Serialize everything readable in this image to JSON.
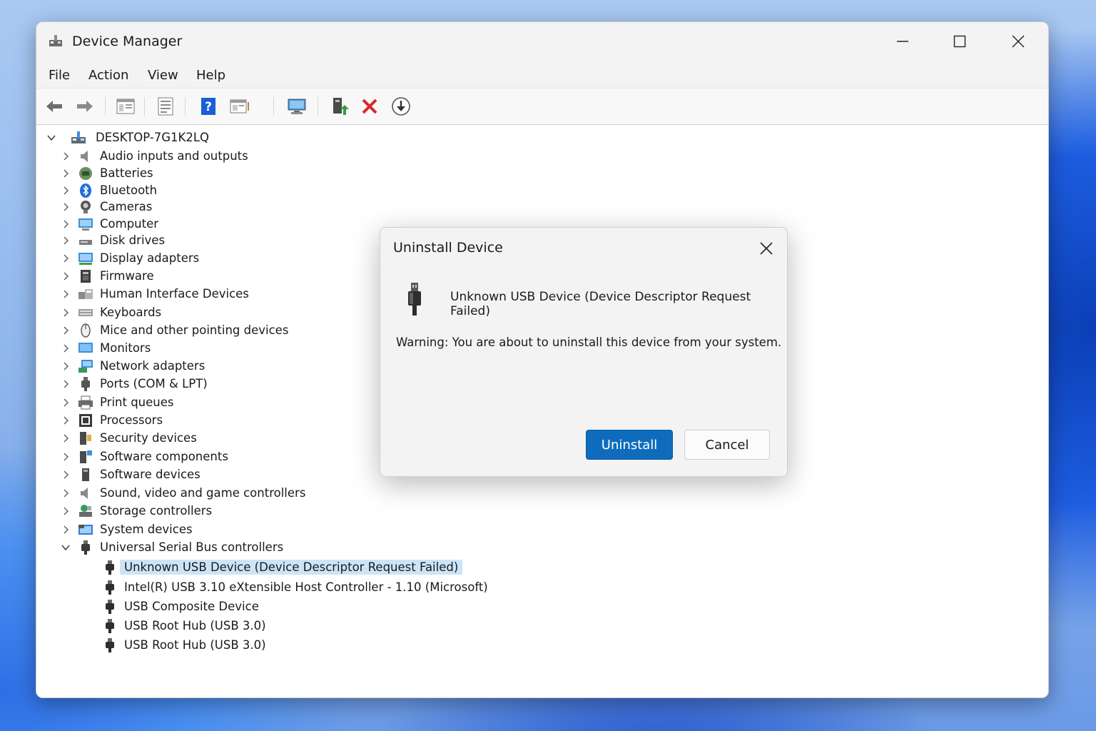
{
  "window": {
    "title": "Device Manager",
    "controls": [
      "minimize-icon",
      "maximize-icon",
      "close-icon"
    ]
  },
  "menu": [
    "File",
    "Action",
    "View",
    "Help"
  ],
  "toolbar": {
    "icons": [
      "back-arrow-icon",
      "forward-arrow-icon",
      "show-hide-console-tree-icon",
      "properties-icon",
      "help-icon",
      "action-pane-icon",
      "scan-hardware-icon",
      "update-driver-icon",
      "uninstall-device-icon",
      "download-driver-icon"
    ]
  },
  "tree": {
    "root": "DESKTOP-7G1K2LQ",
    "categories": [
      "Audio inputs and outputs",
      "Batteries",
      "Bluetooth",
      "Cameras",
      "Computer",
      "Disk drives",
      "Display adapters",
      "Firmware",
      "Human Interface Devices",
      "Keyboards",
      "Mice and other pointing devices",
      "Monitors",
      "Network adapters",
      "Ports (COM & LPT)",
      "Print queues",
      "Processors",
      "Security devices",
      "Software components",
      "Software devices",
      "Sound, video and game controllers",
      "Storage controllers",
      "System devices",
      "Universal Serial Bus controllers"
    ],
    "usb_children": [
      "Unknown USB Device (Device Descriptor Request Failed)",
      "Intel(R) USB 3.10 eXtensible Host Controller - 1.10 (Microsoft)",
      "USB Composite Device",
      "USB Root Hub (USB 3.0)",
      "USB Root Hub (USB 3.0)"
    ]
  },
  "dialog": {
    "title": "Uninstall Device",
    "device_name": "Unknown USB Device (Device Descriptor Request Failed)",
    "warning": "Warning: You are about to uninstall this device from your system.",
    "uninstall_label": "Uninstall",
    "cancel_label": "Cancel"
  },
  "colors": {
    "accent": "#0f6cbd",
    "selection": "#cce4f7",
    "delete_red": "#d62828"
  }
}
